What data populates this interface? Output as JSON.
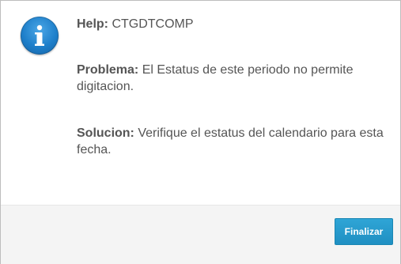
{
  "icon": "info-icon",
  "help": {
    "label": "Help:",
    "value": "CTGDTCOMP"
  },
  "problema": {
    "label": "Problema:",
    "text": "El Estatus de este periodo no permite digitacion."
  },
  "solucion": {
    "label": "Solucion:",
    "text": "Verifique el estatus del calendario para esta fecha."
  },
  "footer": {
    "finalizar_label": "Finalizar"
  },
  "colors": {
    "accent": "#2098cc",
    "text": "#555555",
    "footer_bg": "#f4f4f4"
  }
}
